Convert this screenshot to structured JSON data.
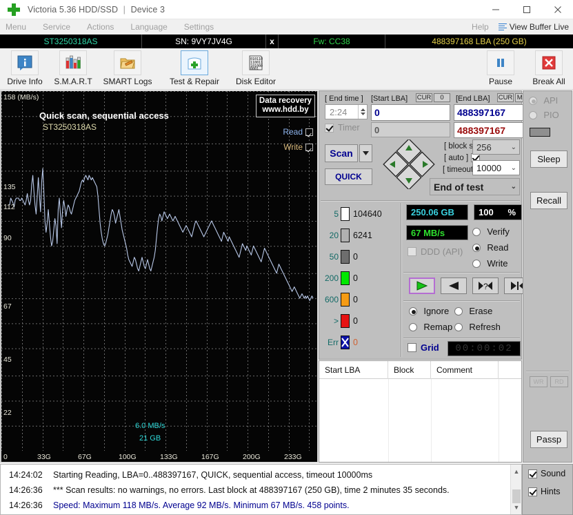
{
  "window": {
    "title": "Victoria 5.36 HDD/SSD",
    "separator": "|",
    "device": "Device 3",
    "minimize": "minimize-icon",
    "maximize": "maximize-icon",
    "close": "close-icon"
  },
  "menubar": {
    "items": [
      "Menu",
      "Service",
      "Actions",
      "Language",
      "Settings"
    ],
    "help": "Help",
    "view_buffer_live": "View Buffer Live"
  },
  "drivebar": {
    "model": "ST3250318AS",
    "serial": "SN: 9VY7JV4G",
    "x": "x",
    "firmware": "Fw: CC38",
    "capacity": "488397168 LBA (250 GB)"
  },
  "toolbar": {
    "items": [
      {
        "label": "Drive Info",
        "icon": "drive-info-icon",
        "selected": false
      },
      {
        "label": "S.M.A.R.T",
        "icon": "smart-icon",
        "selected": false
      },
      {
        "label": "SMART Logs",
        "icon": "smart-logs-icon",
        "selected": false
      },
      {
        "label": "Test & Repair",
        "icon": "test-repair-icon",
        "selected": true
      },
      {
        "label": "Disk Editor",
        "icon": "disk-editor-icon",
        "selected": false
      }
    ],
    "pause": {
      "label": "Pause",
      "icon": "pause-icon"
    },
    "break_all": {
      "label": "Break All",
      "icon": "break-all-icon"
    }
  },
  "chart_data": {
    "type": "line",
    "title": "Quick scan, sequential access",
    "subtitle": "ST3250318AS",
    "xlabel": "",
    "ylabel": "158 (MB/s)",
    "y_axis_unit_label": "158 (MB/s)",
    "yticks": [
      158,
      135,
      112,
      90,
      67,
      45,
      22
    ],
    "ytick_labels": [
      "158 (MB/s)",
      "135",
      "112",
      "90",
      "67",
      "45",
      "22"
    ],
    "ylim": [
      0,
      158
    ],
    "xticks": [
      0,
      33,
      67,
      100,
      133,
      167,
      200,
      233
    ],
    "xtick_labels": [
      "0",
      "33G",
      "67G",
      "100G",
      "133G",
      "167G",
      "200G",
      "233G"
    ],
    "xlim": [
      0,
      250
    ],
    "grid": true,
    "line_color": "#b8c8e8",
    "background": "#050505",
    "annotations": [
      {
        "text": "6.0 MB/s",
        "color": "#2fd9d9"
      },
      {
        "text": "21 GB",
        "color": "#2fd9d9"
      }
    ],
    "overlay_box": {
      "line1": "Data recovery",
      "line2": "www.hdd.by"
    },
    "toggles": [
      {
        "label": "Read",
        "checked": true,
        "color": "#8fb6f0"
      },
      {
        "label": "Write",
        "checked": true,
        "color": "#d9b97c"
      }
    ],
    "series": [
      {
        "name": "Read speed (MB/s)",
        "values": [
          108,
          111,
          110,
          109,
          107,
          110,
          111,
          111,
          111,
          110,
          110,
          111,
          110,
          109,
          108,
          110,
          113,
          110,
          108,
          110,
          117,
          121,
          114,
          108,
          104,
          112,
          120,
          112,
          105,
          118,
          124,
          114,
          101,
          96,
          100,
          106,
          100,
          94,
          90,
          92,
          97,
          102,
          99,
          91,
          106,
          111,
          104,
          98,
          106,
          110,
          107,
          103,
          106,
          108,
          107,
          105,
          104,
          106,
          108,
          110,
          111,
          112,
          113,
          114,
          116,
          118,
          119,
          118,
          120,
          121,
          120,
          119,
          121,
          120,
          119,
          120,
          119,
          118,
          117,
          116,
          112,
          106,
          100,
          96,
          93,
          91,
          90,
          91,
          93,
          95,
          98,
          101,
          104,
          106,
          105,
          103,
          100,
          102,
          104,
          106,
          103,
          100,
          97,
          95,
          93,
          91,
          89,
          86,
          84,
          83,
          82,
          81,
          83,
          85,
          84,
          82,
          80,
          79,
          81,
          83,
          85,
          83,
          81,
          80,
          82,
          84,
          82,
          80,
          79,
          81,
          83,
          85,
          88,
          93,
          98,
          102,
          104,
          103,
          101,
          103,
          105,
          104,
          103,
          102,
          103,
          104,
          103,
          102,
          101,
          102,
          103,
          102,
          101,
          100,
          99,
          98,
          97,
          96,
          97,
          98,
          99,
          98,
          97,
          96,
          95,
          94,
          96,
          98,
          100,
          101,
          100,
          99,
          98,
          97,
          96,
          95,
          94,
          95,
          96,
          97,
          98,
          99,
          100,
          101,
          100,
          99,
          98,
          97,
          96,
          95,
          94,
          93,
          92,
          94,
          96,
          95,
          94,
          93,
          92,
          94,
          93,
          92,
          91,
          90,
          89,
          88,
          87,
          86,
          85,
          87,
          89,
          91,
          90,
          89,
          88,
          90,
          89,
          88,
          87,
          86,
          88,
          90,
          89,
          88,
          87,
          86,
          85,
          84,
          83,
          85,
          87,
          89,
          88,
          87,
          86,
          85,
          84,
          83,
          82,
          81,
          80,
          79,
          78,
          80,
          82,
          81,
          80,
          79,
          78,
          77,
          76,
          75,
          74,
          73,
          72,
          71,
          70,
          71,
          72,
          71,
          70,
          69,
          68,
          67,
          68,
          69,
          68,
          67,
          68,
          67,
          68,
          67,
          66,
          67,
          68,
          67
        ]
      }
    ]
  },
  "controls": {
    "end_time": {
      "label": "[ End time ]",
      "value": "2:24"
    },
    "timer": {
      "label": "Timer",
      "checked": true
    },
    "start_lba": {
      "label": "[Start LBA]",
      "cur_button": "CUR",
      "zero_button": "0",
      "value": "0",
      "second_value": "0"
    },
    "end_lba": {
      "label": "[End LBA]",
      "cur_button": "CUR",
      "max_button": "MAX",
      "value": "488397167",
      "second_value": "488397167"
    },
    "scan_button": "Scan",
    "scan_dropdown": "chevron-down-icon",
    "quick_button": "QUICK",
    "nav_pad": [
      "up-arrow-icon",
      "left-arrow-icon",
      "right-arrow-icon",
      "down-arrow-icon"
    ],
    "block_size": {
      "label": "[ block size ]",
      "value": "256"
    },
    "auto": {
      "label": "[ auto ]",
      "checked": true
    },
    "timeout": {
      "label": "[ timeout,ms ]",
      "value": "10000"
    },
    "end_of_test": {
      "value": "End of test"
    }
  },
  "legend": {
    "rows": [
      {
        "threshold": "5",
        "color": "#ffffff",
        "count": "104640"
      },
      {
        "threshold": "20",
        "color": "#b0b0b0",
        "count": "6241"
      },
      {
        "threshold": "50",
        "color": "#6e6e6e",
        "count": "0"
      },
      {
        "threshold": "200",
        "color": "#00e800",
        "count": "0"
      },
      {
        "threshold": "600",
        "color": "#f59b14",
        "count": "0"
      },
      {
        "threshold": ">",
        "color": "#e61212",
        "count": "0"
      },
      {
        "threshold": "Err",
        "color": "#0b12a8",
        "count": "0"
      }
    ]
  },
  "status": {
    "capacity_lcd": "250.06 GB",
    "capacity_color": "#3ad2e0",
    "percent": "100",
    "percent_unit": "%",
    "speed_lcd": "67 MB/s",
    "speed_color": "#2ee02e",
    "ddd_api": {
      "label": "DDD (API)",
      "checked": false
    },
    "modes": [
      {
        "label": "Verify",
        "selected": false
      },
      {
        "label": "Read",
        "selected": true
      },
      {
        "label": "Write",
        "selected": false
      }
    ],
    "transport_buttons": [
      "play-icon",
      "reverse-icon",
      "random-icon",
      "butterfly-icon"
    ],
    "actions": [
      {
        "label": "Ignore",
        "selected": true
      },
      {
        "label": "Erase",
        "selected": false
      },
      {
        "label": "Remap",
        "selected": false
      },
      {
        "label": "Refresh",
        "selected": false
      }
    ],
    "grid": {
      "label": "Grid",
      "checked": false
    },
    "clock": "00:00:02"
  },
  "table": {
    "columns": [
      "Start LBA",
      "Block",
      "Comment"
    ],
    "rows": []
  },
  "sidebar": {
    "api": {
      "label": "API",
      "selected": true
    },
    "pio": {
      "label": "PIO",
      "selected": false
    },
    "indicator": "activity-indicator",
    "sleep": "Sleep",
    "recall": "Recall",
    "small_buttons": [
      "WR",
      "RD"
    ],
    "passp": "Passp"
  },
  "log": {
    "entries": [
      {
        "time": "14:24:02",
        "text": "Starting Reading, LBA=0..488397167, QUICK, sequential access, timeout 10000ms",
        "color": "black"
      },
      {
        "time": "14:26:36",
        "text": "*** Scan results: no warnings, no errors. Last block at 488397167 (250 GB), time 2 minutes 35 seconds.",
        "color": "black"
      },
      {
        "time": "14:26:36",
        "text": "Speed: Maximum 118 MB/s. Average 92 MB/s. Minimum 67 MB/s. 458 points.",
        "color": "blue"
      }
    ],
    "scroll_up": "scroll-up-icon",
    "scroll_down": "scroll-down-icon"
  },
  "options": {
    "sound": {
      "label": "Sound",
      "checked": true
    },
    "hints": {
      "label": "Hints",
      "checked": true
    }
  }
}
